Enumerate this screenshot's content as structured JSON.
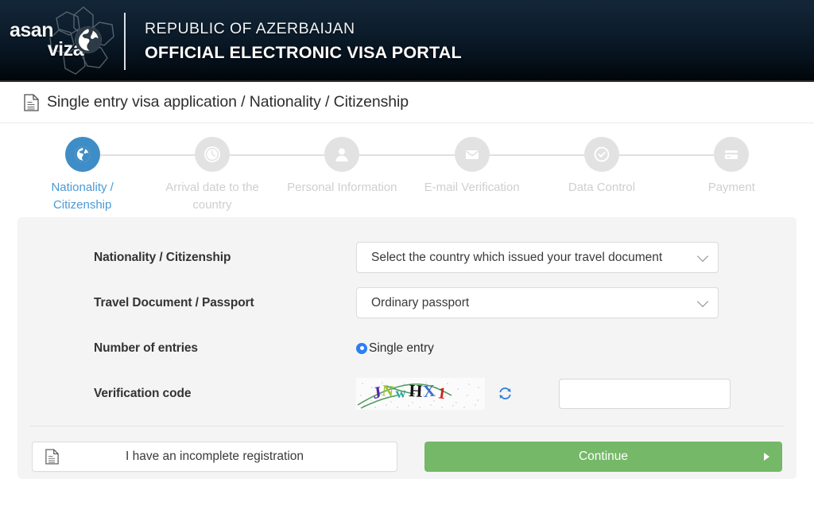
{
  "header": {
    "logo_line1": "asan",
    "logo_line2": "viza",
    "title_line1": "REPUBLIC OF AZERBAIJAN",
    "title_line2": "OFFICIAL ELECTRONIC VISA PORTAL",
    "background_color": "#0d1d2c"
  },
  "breadcrumb": {
    "icon": "document-icon",
    "text": "Single entry visa application / Nationality / Citizenship"
  },
  "stepper": {
    "active_index": 0,
    "active_color": "#3f8dc6",
    "active_label_color": "#4a9ad4",
    "inactive_color": "#e2e2e2",
    "steps": [
      {
        "label": "Nationality / Citizenship",
        "icon": "globe-icon",
        "state": "active"
      },
      {
        "label": "Arrival date to the country",
        "icon": "clock-icon",
        "state": "inactive"
      },
      {
        "label": "Personal Information",
        "icon": "person-icon",
        "state": "inactive"
      },
      {
        "label": "E-mail Verification",
        "icon": "envelope-icon",
        "state": "inactive"
      },
      {
        "label": "Data Control",
        "icon": "check-circle-icon",
        "state": "inactive"
      },
      {
        "label": "Payment",
        "icon": "credit-card-icon",
        "state": "inactive"
      }
    ]
  },
  "form": {
    "nationality": {
      "label": "Nationality / Citizenship",
      "value": "Select the country which issued your travel document"
    },
    "travel_document": {
      "label": "Travel Document / Passport",
      "value": "Ordinary passport"
    },
    "entries": {
      "label": "Number of entries",
      "option_label": "Single entry",
      "checked": true,
      "radio_color": "#2f7ef5"
    },
    "verification": {
      "label": "Verification code",
      "captcha_text": "JNwHX1",
      "refresh_icon": "refresh-icon",
      "input_value": "",
      "input_placeholder": ""
    }
  },
  "actions": {
    "incomplete_label": "I have an incomplete registration",
    "incomplete_icon": "document-icon",
    "continue_label": "Continue",
    "continue_icon": "arrow-right-icon",
    "continue_color": "#74b868"
  }
}
